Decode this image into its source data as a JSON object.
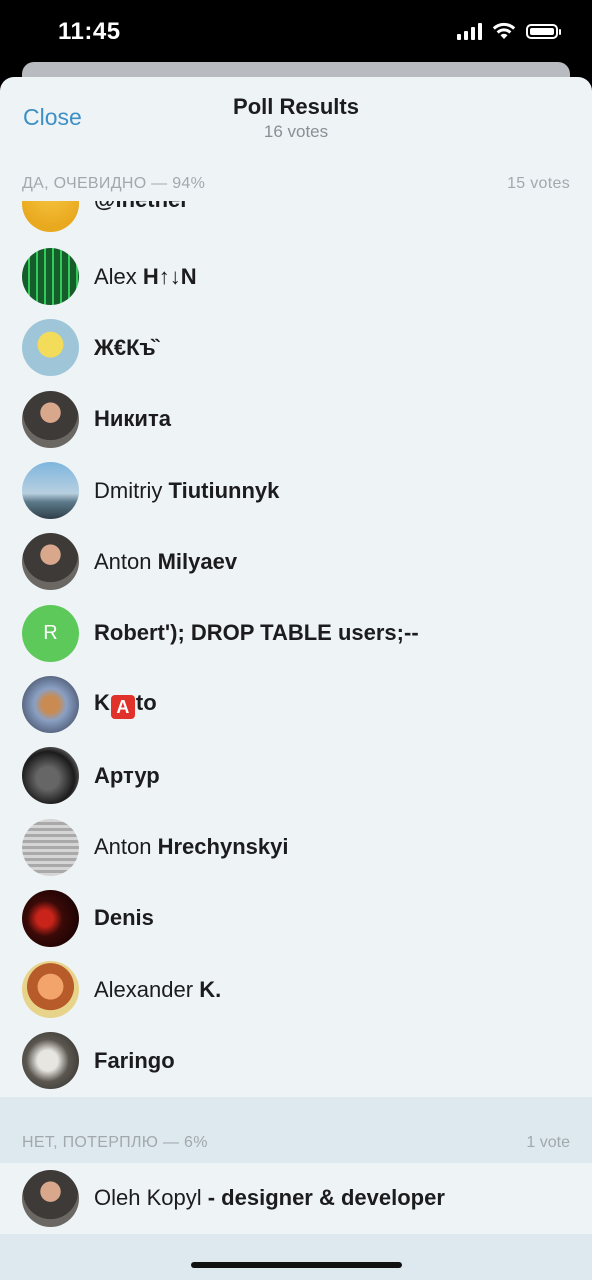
{
  "status_bar": {
    "time": "11:45"
  },
  "sheet": {
    "close_label": "Close",
    "title": "Poll Results",
    "subtitle": "16 votes"
  },
  "sections": [
    {
      "label": "ДА, ОЧЕВИДНО — 94%",
      "count": "15 votes",
      "voters": [
        {
          "first": "@lnether",
          "last": "",
          "avatar": "yellow-avatar"
        },
        {
          "first": "Alex",
          "last": "H↑↓N",
          "avatar": "green-grid-avatar"
        },
        {
          "first": "Ж€Къ̏",
          "last": "",
          "avatar": "yellow-figure-avatar"
        },
        {
          "first": "Никита",
          "last": "",
          "avatar": "person-photo-avatar"
        },
        {
          "first": "Dmitriy",
          "last": "Tiutiunnyk",
          "avatar": "sky-photo-avatar"
        },
        {
          "first": "Anton",
          "last": "Milyaev",
          "avatar": "person-photo-avatar"
        },
        {
          "first": "Robert'); DROP TABLE users;--",
          "last": "",
          "avatar": "letter-r-avatar",
          "initial": "R"
        },
        {
          "first": "K",
          "badge": "A",
          "after": "to",
          "last": "",
          "avatar": "blurred-avatar"
        },
        {
          "first": "Артур",
          "last": "",
          "avatar": "car-photo-avatar"
        },
        {
          "first": "Anton",
          "last": "Hrechynskyi",
          "avatar": "bw-photo-avatar"
        },
        {
          "first": "Denis",
          "last": "",
          "avatar": "red-dark-avatar"
        },
        {
          "first": "Alexander",
          "last": "K.",
          "avatar": "cartoon-avatar"
        },
        {
          "first": "Faringo",
          "last": "",
          "avatar": "mask-photo-avatar"
        }
      ]
    },
    {
      "label": "НЕТ, ПОТЕРПЛЮ — 6%",
      "count": "1 vote",
      "voters": [
        {
          "first": "Oleh Kopyl",
          "last": "- designer & developer",
          "avatar": "person-photo-avatar"
        }
      ]
    }
  ],
  "colors": {
    "accent": "#3e8fc6",
    "sheet_bg": "#eef3f6",
    "section_bg": "#dde9ee",
    "header_text": "#a3a8ad",
    "robert_avatar": "#5cc95a"
  }
}
